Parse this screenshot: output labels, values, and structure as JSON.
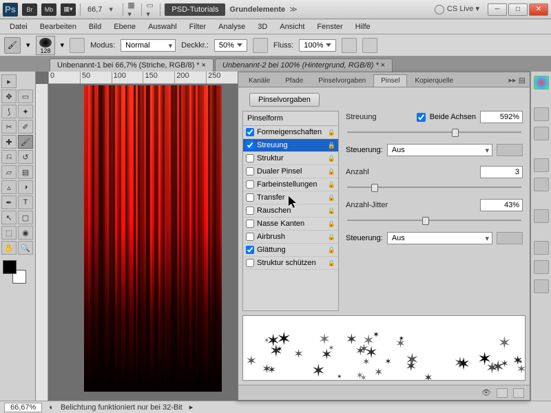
{
  "titlebar": {
    "ps": "Ps",
    "badges": [
      "Br",
      "Mb"
    ],
    "zoom": "66,7",
    "tab_button": "PSD-Tutorials",
    "doc_title": "Grundelemente",
    "chevrons": "≫",
    "cslive": "CS Live"
  },
  "menu": [
    "Datei",
    "Bearbeiten",
    "Bild",
    "Ebene",
    "Auswahl",
    "Filter",
    "Analyse",
    "3D",
    "Ansicht",
    "Fenster",
    "Hilfe"
  ],
  "options": {
    "brush_size": "128",
    "mode_label": "Modus:",
    "mode_value": "Normal",
    "opacity_label": "Deckkr.:",
    "opacity_value": "50%",
    "flow_label": "Fluss:",
    "flow_value": "100%"
  },
  "docs": [
    {
      "title": "Unbenannt-1 bei 66,7% (Striche, RGB/8) *",
      "active": true
    },
    {
      "title": "Unbenannt-2 bei 100% (Hintergrund, RGB/8) *",
      "active": false
    }
  ],
  "ruler_marks": [
    "0",
    "50",
    "100",
    "150",
    "200",
    "250"
  ],
  "panel": {
    "tabs": [
      "Kanäle",
      "Pfade",
      "Pinselvorgaben",
      "Pinsel",
      "Kopierquelle"
    ],
    "active_tab": "Pinsel",
    "presets_btn": "Pinselvorgaben",
    "shape_header": "Pinselform",
    "options": [
      {
        "label": "Formeigenschaften",
        "checked": true,
        "selected": false
      },
      {
        "label": "Streuung",
        "checked": true,
        "selected": true
      },
      {
        "label": "Struktur",
        "checked": false,
        "selected": false
      },
      {
        "label": "Dualer Pinsel",
        "checked": false,
        "selected": false
      },
      {
        "label": "Farbeinstellungen",
        "checked": false,
        "selected": false
      },
      {
        "label": "Transfer",
        "checked": false,
        "selected": false
      },
      {
        "label": "Rauschen",
        "checked": false,
        "selected": false
      },
      {
        "label": "Nasse Kanten",
        "checked": false,
        "selected": false
      },
      {
        "label": "Airbrush",
        "checked": false,
        "selected": false
      },
      {
        "label": "Glättung",
        "checked": true,
        "selected": false
      },
      {
        "label": "Struktur schützen",
        "checked": false,
        "selected": false
      }
    ],
    "scatter": {
      "scatter_label": "Streuung",
      "both_axes_label": "Beide Achsen",
      "both_axes_checked": true,
      "scatter_value": "592%",
      "control_label": "Steuerung:",
      "control_value": "Aus",
      "count_label": "Anzahl",
      "count_value": "3",
      "jitter_label": "Anzahl-Jitter",
      "jitter_value": "43%",
      "control2_value": "Aus"
    }
  },
  "status": {
    "zoom": "66,67%",
    "msg": "Belichtung funktioniert nur bei 32-Bit"
  },
  "icons": {
    "brush": "🖌",
    "move": "↔",
    "marquee": "▭",
    "lasso": "⟆",
    "wand": "✦",
    "crop": "✂",
    "eyedrop": "✎",
    "heal": "✚",
    "stamp": "⎇",
    "history": "↺",
    "eraser": "▱",
    "grad": "▤",
    "blur": "▵",
    "dodge": "◑",
    "pen": "✒",
    "type": "T",
    "path": "↖",
    "shape": "▢",
    "hand": "✋",
    "zoom": "🔍"
  }
}
